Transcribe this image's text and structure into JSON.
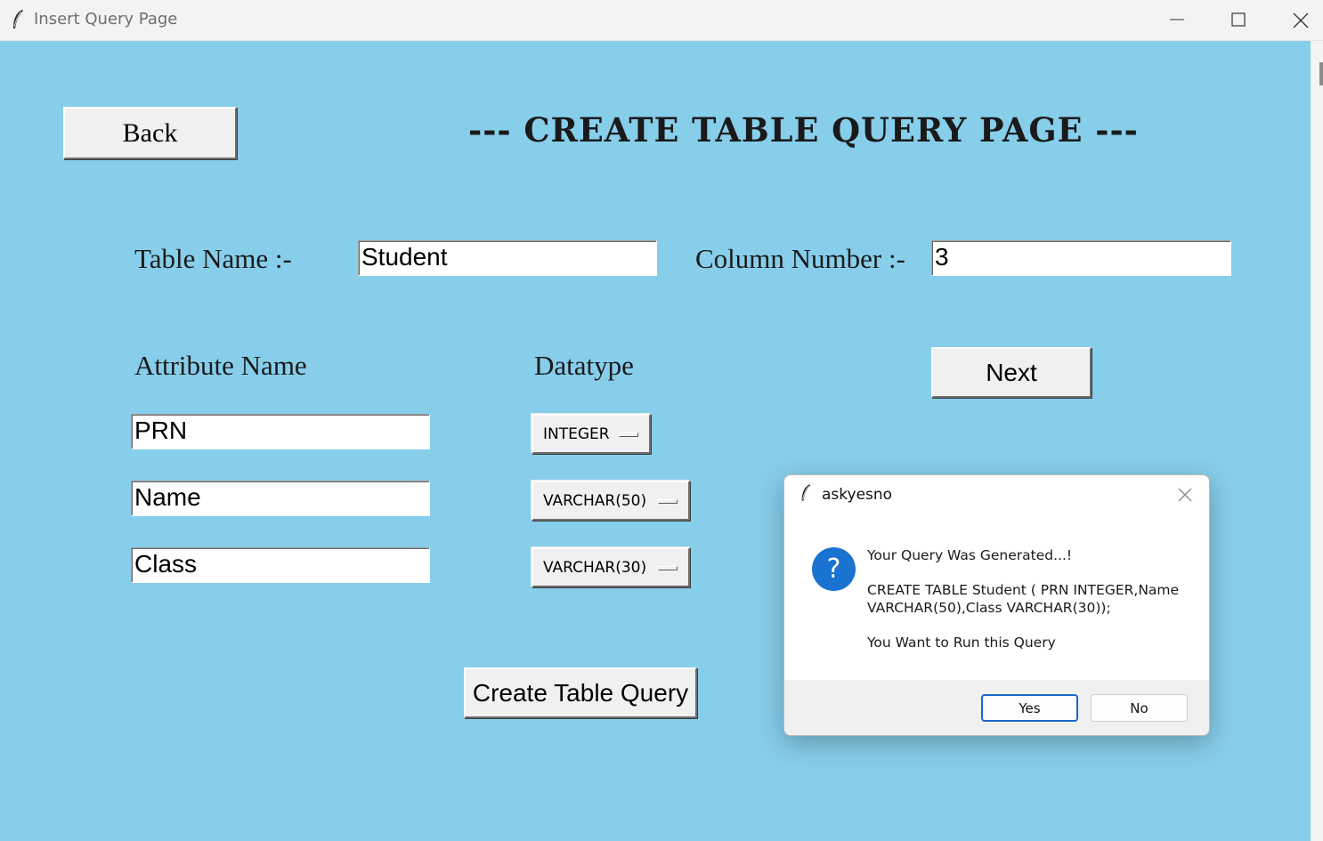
{
  "window": {
    "title": "Insert Query Page",
    "app_icon": "feather-icon",
    "controls": [
      "minimize-icon",
      "maximize-icon",
      "close-icon"
    ]
  },
  "page": {
    "back_label": "Back",
    "title": "--- CREATE TABLE QUERY PAGE ---",
    "table_name_label": "Table Name :-",
    "table_name_value": "Student",
    "column_number_label": "Column Number :-",
    "column_number_value": "3",
    "next_label": "Next",
    "attribute_header": "Attribute Name",
    "datatype_header": "Datatype",
    "attributes": [
      {
        "name": "PRN",
        "datatype": "INTEGER"
      },
      {
        "name": "Name",
        "datatype": "VARCHAR(50)"
      },
      {
        "name": "Class",
        "datatype": "VARCHAR(30)"
      }
    ],
    "create_label": "Create Table Query",
    "background_color": "#87ceeb"
  },
  "dialog": {
    "title": "askyesno",
    "icon": "question-icon",
    "line1": "Your Query Was Generated...!",
    "query_line1": "CREATE TABLE Student ( PRN INTEGER,Name",
    "query_line2": "VARCHAR(50),Class VARCHAR(30));",
    "line3": "You Want to Run this Query",
    "yes_label": "Yes",
    "no_label": "No"
  }
}
